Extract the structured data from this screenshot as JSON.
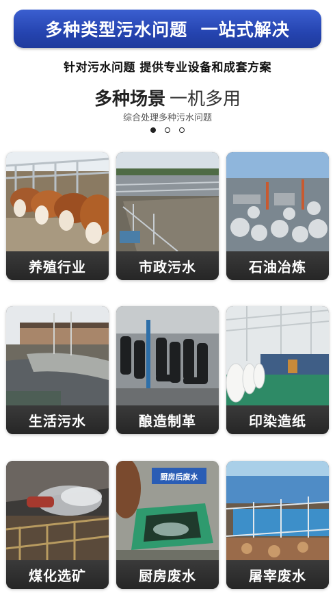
{
  "banner": {
    "title": "多种类型污水问题  一站式解决",
    "color": "#2a4bb8"
  },
  "subtitle": "针对污水问题  提供专业设备和成套方案",
  "section": {
    "heading_bold": "多种场景",
    "heading_light": "一机多用",
    "caption": "综合处理多种污水问题"
  },
  "carousel": {
    "dots": 3,
    "active_index": 0
  },
  "cards": [
    {
      "label": "养殖行业",
      "image": "cattle-farm-photo"
    },
    {
      "label": "市政污水",
      "image": "municipal-treatment-tank-photo"
    },
    {
      "label": "石油冶炼",
      "image": "oil-refinery-photo"
    },
    {
      "label": "生活污水",
      "image": "domestic-sewage-pond-photo"
    },
    {
      "label": "酿造制革",
      "image": "leather-boots-factory-photo"
    },
    {
      "label": "印染造纸",
      "image": "paper-mill-photo"
    },
    {
      "label": "煤化选矿",
      "image": "coal-mining-tunnel-photo"
    },
    {
      "label": "厨房废水",
      "image": "kitchen-wastewater-pit-photo",
      "sign": "厨房后废水"
    },
    {
      "label": "屠宰废水",
      "image": "slaughterhouse-treatment-photo"
    }
  ]
}
